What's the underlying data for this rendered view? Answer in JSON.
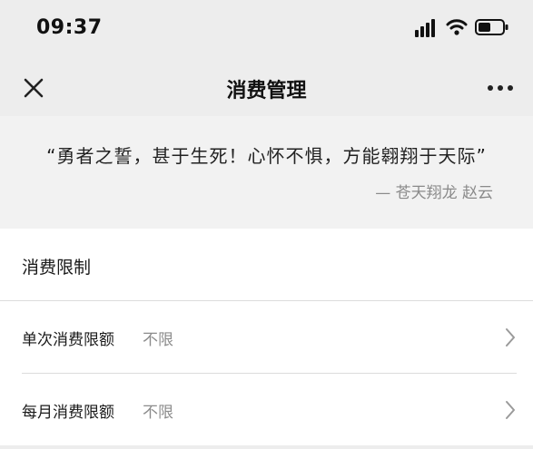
{
  "status_bar": {
    "time": "09:37",
    "icons": [
      "signal-icon",
      "wifi-icon",
      "battery-icon"
    ]
  },
  "nav": {
    "title": "消费管理",
    "close_icon": "close-icon",
    "more_icon": "more-icon"
  },
  "quote": {
    "text": "“勇者之誓，甚于生死！心怀不惧，方能翱翔于天际”",
    "author": "— 苍天翔龙 赵云"
  },
  "section": {
    "title": "消费限制"
  },
  "rows": [
    {
      "label": "单次消费限额",
      "value": "不限"
    },
    {
      "label": "每月消费限额",
      "value": "不限"
    }
  ],
  "colors": {
    "header_bg": "#ededed",
    "quote_bg": "#f2f2f2",
    "secondary_text": "#8c8c8c"
  }
}
